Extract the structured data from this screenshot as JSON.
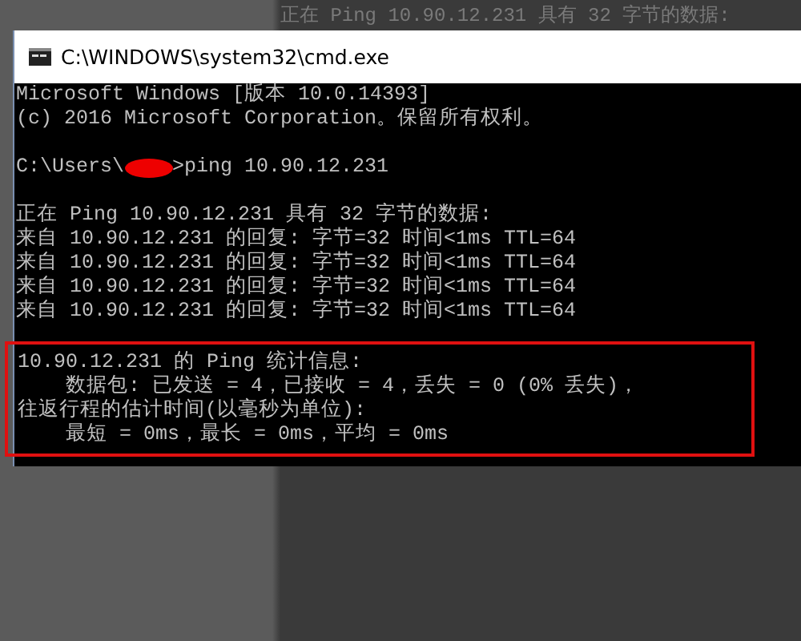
{
  "background_text": "正在 Ping 10.90.12.231 具有 32 字节的数据:",
  "window": {
    "title": "C:\\WINDOWS\\system32\\cmd.exe"
  },
  "console": {
    "lines": [
      {
        "kind": "text",
        "text": "Microsoft Windows [版本 10.0.14393]"
      },
      {
        "kind": "text",
        "text": "(c) 2016 Microsoft Corporation。保留所有权利。"
      },
      {
        "kind": "blank"
      },
      {
        "kind": "prompt",
        "before": "C:\\Users\\",
        "after": ">ping 10.90.12.231"
      },
      {
        "kind": "blank"
      },
      {
        "kind": "text",
        "text": "正在 Ping 10.90.12.231 具有 32 字节的数据:"
      },
      {
        "kind": "text",
        "text": "来自 10.90.12.231 的回复: 字节=32 时间<1ms TTL=64"
      },
      {
        "kind": "text",
        "text": "来自 10.90.12.231 的回复: 字节=32 时间<1ms TTL=64"
      },
      {
        "kind": "text",
        "text": "来自 10.90.12.231 的回复: 字节=32 时间<1ms TTL=64"
      },
      {
        "kind": "text",
        "text": "来自 10.90.12.231 的回复: 字节=32 时间<1ms TTL=64"
      },
      {
        "kind": "blank"
      }
    ],
    "highlighted_lines": [
      {
        "kind": "text",
        "text": "10.90.12.231 的 Ping 统计信息:"
      },
      {
        "kind": "text",
        "text": "    数据包: 已发送 = 4，已接收 = 4，丢失 = 0 (0% 丢失)，"
      },
      {
        "kind": "text",
        "text": "往返行程的估计时间(以毫秒为单位):"
      },
      {
        "kind": "text",
        "text": "    最短 = 0ms，最长 = 0ms，平均 = 0ms"
      }
    ]
  }
}
